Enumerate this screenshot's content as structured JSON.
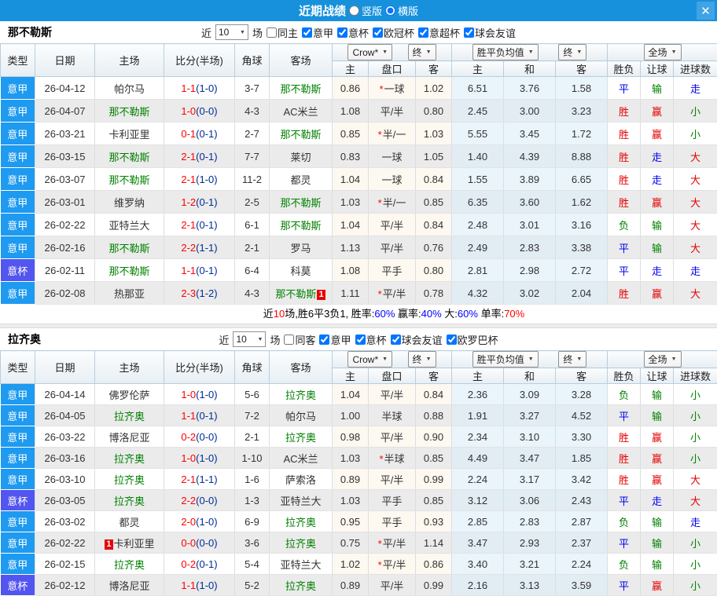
{
  "titlebar": {
    "title": "近期战绩",
    "layout_options": [
      {
        "label": "竖版",
        "selected": false
      },
      {
        "label": "横版",
        "selected": true
      }
    ],
    "close_icon": "✕"
  },
  "star_marker": "*",
  "colors": {
    "titlebar_blue": "#1791dc",
    "league_badge_blue": "#1e9af0",
    "cup_badge_purple": "#5355ef",
    "win_red": "#e60000",
    "draw_blue": "#0000ee",
    "lose_green": "#008000",
    "score_red": "#ff0000",
    "half_score_navy": "#002d96"
  },
  "table_header": {
    "cols": [
      "类型",
      "日期",
      "主场",
      "比分(半场)",
      "角球",
      "客场"
    ],
    "groups": {
      "crow": "Crow*",
      "final1": "终",
      "avg": "胜平负均值",
      "final2": "终",
      "full": "全场"
    },
    "sub": [
      "主",
      "盘口",
      "客",
      "主",
      "和",
      "客",
      "胜负",
      "让球",
      "进球数"
    ]
  },
  "sections": [
    {
      "team": "那不勒斯",
      "filter": {
        "near": "近",
        "count": "10",
        "unit": "场",
        "checkboxes": [
          {
            "label": "同主",
            "checked": false
          },
          {
            "label": "意甲",
            "checked": true
          },
          {
            "label": "意杯",
            "checked": true
          },
          {
            "label": "欧冠杯",
            "checked": true
          },
          {
            "label": "意超杯",
            "checked": true
          },
          {
            "label": "球会友谊",
            "checked": true
          }
        ]
      },
      "rows": [
        {
          "type": "意甲",
          "date": "26-04-12",
          "home": "帕尔马",
          "score": "1-1",
          "half": "(1-0)",
          "corner": "3-7",
          "away": "那不勒斯",
          "crow": [
            "0.86",
            "一球",
            "1.02"
          ],
          "star": true,
          "avg": [
            "6.51",
            "3.76",
            "1.58"
          ],
          "res": [
            "平",
            "输",
            "走"
          ]
        },
        {
          "type": "意甲",
          "date": "26-04-07",
          "home": "那不勒斯",
          "score": "1-0",
          "half": "(0-0)",
          "corner": "4-3",
          "away": "AC米兰",
          "crow": [
            "1.08",
            "平/半",
            "0.80"
          ],
          "star": false,
          "avg": [
            "2.45",
            "3.00",
            "3.23"
          ],
          "res": [
            "胜",
            "赢",
            "小"
          ]
        },
        {
          "type": "意甲",
          "date": "26-03-21",
          "home": "卡利亚里",
          "score": "0-1",
          "half": "(0-1)",
          "corner": "2-7",
          "away": "那不勒斯",
          "crow": [
            "0.85",
            "半/一",
            "1.03"
          ],
          "star": true,
          "avg": [
            "5.55",
            "3.45",
            "1.72"
          ],
          "res": [
            "胜",
            "赢",
            "小"
          ]
        },
        {
          "type": "意甲",
          "date": "26-03-15",
          "home": "那不勒斯",
          "score": "2-1",
          "half": "(0-1)",
          "corner": "7-7",
          "away": "莱切",
          "crow": [
            "0.83",
            "一球",
            "1.05"
          ],
          "star": false,
          "avg": [
            "1.40",
            "4.39",
            "8.88"
          ],
          "res": [
            "胜",
            "走",
            "大"
          ]
        },
        {
          "type": "意甲",
          "date": "26-03-07",
          "home": "那不勒斯",
          "score": "2-1",
          "half": "(1-0)",
          "corner": "11-2",
          "away": "都灵",
          "crow": [
            "1.04",
            "一球",
            "0.84"
          ],
          "star": false,
          "avg": [
            "1.55",
            "3.89",
            "6.65"
          ],
          "res": [
            "胜",
            "走",
            "大"
          ]
        },
        {
          "type": "意甲",
          "date": "26-03-01",
          "home": "维罗纳",
          "score": "1-2",
          "half": "(0-1)",
          "corner": "2-5",
          "away": "那不勒斯",
          "crow": [
            "1.03",
            "半/一",
            "0.85"
          ],
          "star": true,
          "avg": [
            "6.35",
            "3.60",
            "1.62"
          ],
          "res": [
            "胜",
            "赢",
            "大"
          ]
        },
        {
          "type": "意甲",
          "date": "26-02-22",
          "home": "亚特兰大",
          "score": "2-1",
          "half": "(0-1)",
          "corner": "6-1",
          "away": "那不勒斯",
          "crow": [
            "1.04",
            "平/半",
            "0.84"
          ],
          "star": false,
          "avg": [
            "2.48",
            "3.01",
            "3.16"
          ],
          "res": [
            "负",
            "输",
            "大"
          ]
        },
        {
          "type": "意甲",
          "date": "26-02-16",
          "home": "那不勒斯",
          "score": "2-2",
          "half": "(1-1)",
          "corner": "2-1",
          "away": "罗马",
          "crow": [
            "1.13",
            "平/半",
            "0.76"
          ],
          "star": false,
          "avg": [
            "2.49",
            "2.83",
            "3.38"
          ],
          "res": [
            "平",
            "输",
            "大"
          ]
        },
        {
          "type": "意杯",
          "date": "26-02-11",
          "home": "那不勒斯",
          "score": "1-1",
          "half": "(0-1)",
          "corner": "6-4",
          "away": "科莫",
          "crow": [
            "1.08",
            "平手",
            "0.80"
          ],
          "star": false,
          "avg": [
            "2.81",
            "2.98",
            "2.72"
          ],
          "res": [
            "平",
            "走",
            "走"
          ]
        },
        {
          "type": "意甲",
          "date": "26-02-08",
          "home": "热那亚",
          "score": "2-3",
          "half": "(1-2)",
          "corner": "4-3",
          "away": "那不勒斯",
          "away_badge": "1",
          "crow": [
            "1.11",
            "平/半",
            "0.78"
          ],
          "star": true,
          "avg": [
            "4.32",
            "3.02",
            "2.04"
          ],
          "res": [
            "胜",
            "赢",
            "大"
          ]
        }
      ],
      "summary": [
        {
          "t": "近",
          "c": "k"
        },
        {
          "t": "10",
          "c": "r"
        },
        {
          "t": "场,胜6平3负1, 胜率:",
          "c": "k"
        },
        {
          "t": "60%",
          "c": "b"
        },
        {
          "t": " 赢率:",
          "c": "k"
        },
        {
          "t": "40%",
          "c": "b"
        },
        {
          "t": " 大:",
          "c": "k"
        },
        {
          "t": "60%",
          "c": "b"
        },
        {
          "t": " 单率:",
          "c": "k"
        },
        {
          "t": "70%",
          "c": "r"
        }
      ]
    },
    {
      "team": "拉齐奥",
      "filter": {
        "near": "近",
        "count": "10",
        "unit": "场",
        "checkboxes": [
          {
            "label": "同客",
            "checked": false
          },
          {
            "label": "意甲",
            "checked": true
          },
          {
            "label": "意杯",
            "checked": true
          },
          {
            "label": "球会友谊",
            "checked": true
          },
          {
            "label": "欧罗巴杯",
            "checked": true
          }
        ]
      },
      "rows": [
        {
          "type": "意甲",
          "date": "26-04-14",
          "home": "佛罗伦萨",
          "score": "1-0",
          "half": "(1-0)",
          "corner": "5-6",
          "away": "拉齐奥",
          "crow": [
            "1.04",
            "平/半",
            "0.84"
          ],
          "star": false,
          "avg": [
            "2.36",
            "3.09",
            "3.28"
          ],
          "res": [
            "负",
            "输",
            "小"
          ]
        },
        {
          "type": "意甲",
          "date": "26-04-05",
          "home": "拉齐奥",
          "score": "1-1",
          "half": "(0-1)",
          "corner": "7-2",
          "away": "帕尔马",
          "crow": [
            "1.00",
            "半球",
            "0.88"
          ],
          "star": false,
          "avg": [
            "1.91",
            "3.27",
            "4.52"
          ],
          "res": [
            "平",
            "输",
            "小"
          ]
        },
        {
          "type": "意甲",
          "date": "26-03-22",
          "home": "博洛尼亚",
          "score": "0-2",
          "half": "(0-0)",
          "corner": "2-1",
          "away": "拉齐奥",
          "crow": [
            "0.98",
            "平/半",
            "0.90"
          ],
          "star": false,
          "avg": [
            "2.34",
            "3.10",
            "3.30"
          ],
          "res": [
            "胜",
            "赢",
            "小"
          ]
        },
        {
          "type": "意甲",
          "date": "26-03-16",
          "home": "拉齐奥",
          "score": "1-0",
          "half": "(1-0)",
          "corner": "1-10",
          "away": "AC米兰",
          "crow": [
            "1.03",
            "半球",
            "0.85"
          ],
          "star": true,
          "avg": [
            "4.49",
            "3.47",
            "1.85"
          ],
          "res": [
            "胜",
            "赢",
            "小"
          ]
        },
        {
          "type": "意甲",
          "date": "26-03-10",
          "home": "拉齐奥",
          "score": "2-1",
          "half": "(1-1)",
          "corner": "1-6",
          "away": "萨索洛",
          "crow": [
            "0.89",
            "平/半",
            "0.99"
          ],
          "star": false,
          "avg": [
            "2.24",
            "3.17",
            "3.42"
          ],
          "res": [
            "胜",
            "赢",
            "大"
          ]
        },
        {
          "type": "意杯",
          "date": "26-03-05",
          "home": "拉齐奥",
          "score": "2-2",
          "half": "(0-0)",
          "corner": "1-3",
          "away": "亚特兰大",
          "crow": [
            "1.03",
            "平手",
            "0.85"
          ],
          "star": false,
          "avg": [
            "3.12",
            "3.06",
            "2.43"
          ],
          "res": [
            "平",
            "走",
            "大"
          ]
        },
        {
          "type": "意甲",
          "date": "26-03-02",
          "home": "都灵",
          "score": "2-0",
          "half": "(1-0)",
          "corner": "6-9",
          "away": "拉齐奥",
          "crow": [
            "0.95",
            "平手",
            "0.93"
          ],
          "star": false,
          "avg": [
            "2.85",
            "2.83",
            "2.87"
          ],
          "res": [
            "负",
            "输",
            "走"
          ]
        },
        {
          "type": "意甲",
          "date": "26-02-22",
          "home": "卡利亚里",
          "home_badge": "1",
          "score": "0-0",
          "half": "(0-0)",
          "corner": "3-6",
          "away": "拉齐奥",
          "crow": [
            "0.75",
            "平/半",
            "1.14"
          ],
          "star": true,
          "avg": [
            "3.47",
            "2.93",
            "2.37"
          ],
          "res": [
            "平",
            "输",
            "小"
          ]
        },
        {
          "type": "意甲",
          "date": "26-02-15",
          "home": "拉齐奥",
          "score": "0-2",
          "half": "(0-1)",
          "corner": "5-4",
          "away": "亚特兰大",
          "crow": [
            "1.02",
            "平/半",
            "0.86"
          ],
          "star": true,
          "avg": [
            "3.40",
            "3.21",
            "2.24"
          ],
          "res": [
            "负",
            "输",
            "小"
          ]
        },
        {
          "type": "意杯",
          "date": "26-02-12",
          "home": "博洛尼亚",
          "score": "1-1",
          "half": "(1-0)",
          "corner": "5-2",
          "away": "拉齐奥",
          "crow": [
            "0.89",
            "平/半",
            "0.99"
          ],
          "star": false,
          "avg": [
            "2.16",
            "3.13",
            "3.59"
          ],
          "res": [
            "平",
            "赢",
            "小"
          ]
        }
      ],
      "summary": null
    }
  ]
}
